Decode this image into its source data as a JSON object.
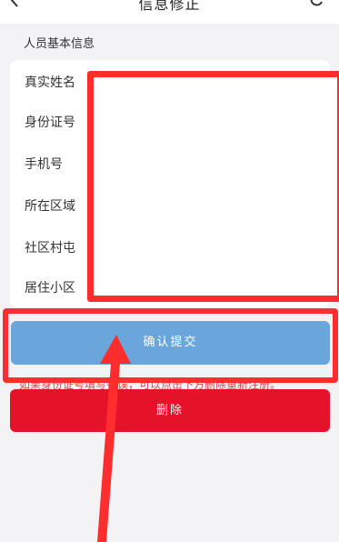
{
  "header": {
    "title": "信息修正",
    "back_icon": "chevron-left-icon",
    "refresh_icon": "refresh-icon"
  },
  "section": {
    "title": "人员基本信息"
  },
  "fields": [
    {
      "label": "真实姓名"
    },
    {
      "label": "身份证号"
    },
    {
      "label": "手机号"
    },
    {
      "label": "所在区域"
    },
    {
      "label": "社区村屯"
    },
    {
      "label": "居住小区"
    }
  ],
  "actions": {
    "confirm_label": "确认提交",
    "hint": "如果身份证号填写错误，可以点击下方删除重新注册。",
    "delete_label": "删除"
  },
  "colors": {
    "confirm": "#6aa6dc",
    "delete": "#e5132a",
    "highlight": "#ff2d2d"
  }
}
